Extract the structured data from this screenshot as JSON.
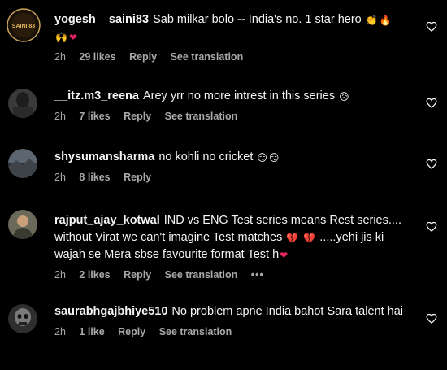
{
  "comments": [
    {
      "username": "yogesh__saini83",
      "text": "Sab milkar bolo -- India's no. 1 star hero",
      "emojis_inline": [
        "clapping-hands",
        "fire"
      ],
      "emojis_line2": [
        "raising-hands",
        "red-heart"
      ],
      "time": "2h",
      "likes": "29 likes",
      "reply": "Reply",
      "see_translation": "See translation"
    },
    {
      "username": "__itz.m3_reena",
      "text": "Arey yrr no more intrest in this series",
      "emojis_inline": [
        "sad-face"
      ],
      "time": "2h",
      "likes": "7 likes",
      "reply": "Reply",
      "see_translation": "See translation"
    },
    {
      "username": "shysumansharma",
      "text": "no kohli no cricket",
      "emojis_inline": [
        "smirking-face",
        "smirking-face"
      ],
      "time": "2h",
      "likes": "8 likes",
      "reply": "Reply"
    },
    {
      "username": "rajput_ajay_kotwal",
      "text_line1": "IND vs ENG Test series means Rest series....",
      "text_line2": "without Virat we can't imagine Test matches",
      "text_line2_after": ".....yehi jis ki",
      "text_line3": "wajah se Mera sbse favourite format Test h",
      "emojis_line2": [
        "broken-heart",
        "broken-heart"
      ],
      "emojis_line3": [
        "red-heart"
      ],
      "time": "2h",
      "likes": "2 likes",
      "reply": "Reply",
      "see_translation": "See translation",
      "more": "•••"
    },
    {
      "username": "saurabhgajbhiye510",
      "text": "No problem apne India bahot Sara talent hai",
      "time": "2h",
      "likes": "1 like",
      "reply": "Reply",
      "see_translation": "See translation"
    }
  ],
  "avatar_logo_text": "SAINI 83",
  "colors": {
    "background": "#000000",
    "text": "#f5f5f5",
    "meta": "#a8a8a8"
  }
}
